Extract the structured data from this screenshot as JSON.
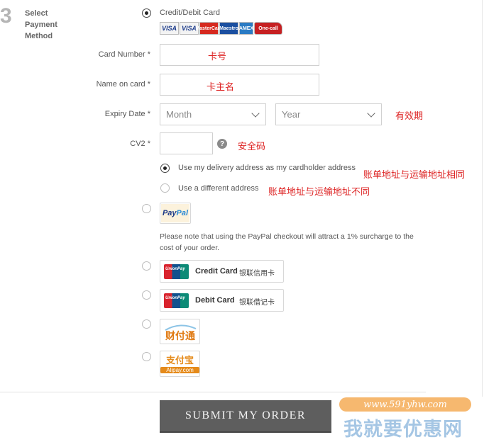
{
  "step": {
    "number": "3",
    "label": "Select Payment Method"
  },
  "credit_card_option": {
    "label": "Credit/Debit Card",
    "selected": true
  },
  "card_logos": [
    "VISA",
    "VISA",
    "MasterCard",
    "Maestro",
    "AMEX",
    "One-call"
  ],
  "fields": {
    "card_number": {
      "label": "Card Number *",
      "value": "",
      "annotation": "卡号"
    },
    "name_on_card": {
      "label": "Name on card *",
      "value": "",
      "annotation": "卡主名"
    },
    "expiry": {
      "label": "Expiry Date *",
      "month": "Month",
      "year": "Year",
      "annotation": "有效期"
    },
    "cv2": {
      "label": "CV2 *",
      "value": "",
      "help": "?",
      "annotation": "安全码"
    }
  },
  "address_options": [
    {
      "label": "Use my delivery address as my cardholder address",
      "selected": true,
      "annotation": "账单地址与运输地址相同"
    },
    {
      "label": "Use a different address",
      "selected": false,
      "annotation": "账单地址与运输地址不同"
    }
  ],
  "paypal": {
    "logo_pay": "Pay",
    "logo_pal": "Pal",
    "note": "Please note that using the PayPal checkout will attract a 1% surcharge to the cost of your order."
  },
  "unionpay_credit": {
    "label": "Credit Card",
    "label_cn": "银联信用卡"
  },
  "unionpay_debit": {
    "label": "Debit Card",
    "label_cn": "银联借记卡"
  },
  "tenpay": {
    "label": "财付通"
  },
  "alipay": {
    "label": "支付宝",
    "sub": "Alipay.com"
  },
  "submit": {
    "label": "SUBMIT MY ORDER"
  },
  "watermark": {
    "url": "www.591yhw.com",
    "text": "我就要优惠网"
  },
  "colors": {
    "annotation": "#dd2222",
    "button": "#5e5e5e",
    "paypal_bg": "#fcf2dc"
  }
}
